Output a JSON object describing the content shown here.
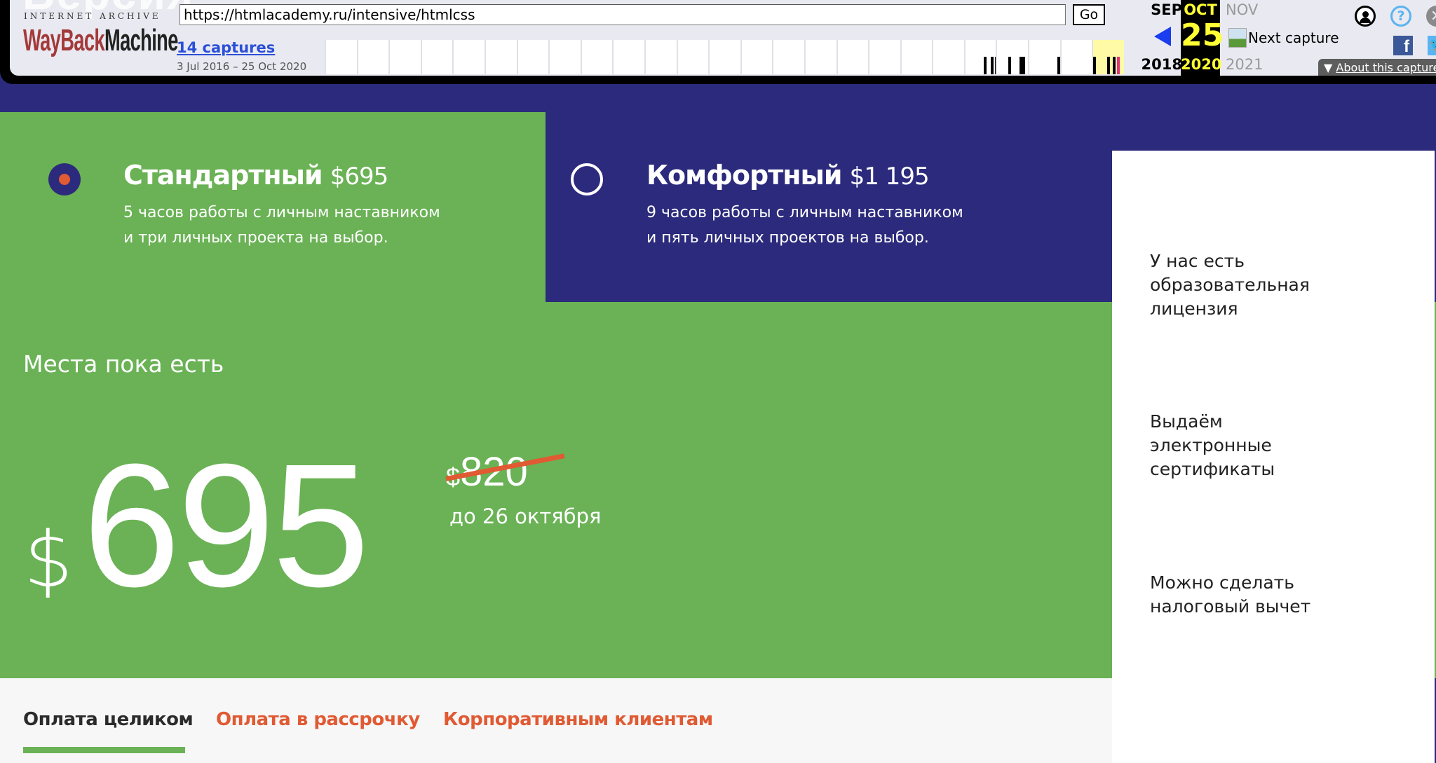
{
  "wayback": {
    "ghost_heading": "Версия",
    "ia_label": "INTERNET ARCHIVE",
    "logo_red": "WayBack",
    "logo_dark": "Machine",
    "url": "https://htmlacademy.ru/intensive/htmlcss",
    "go_label": "Go",
    "captures_link": "14 captures",
    "capture_range": "3 Jul 2016 – 25 Oct 2020",
    "calendar": {
      "prev": {
        "month": "SEP",
        "year": "2018"
      },
      "current": {
        "month": "OCT",
        "day": "25",
        "year": "2020"
      },
      "next": {
        "month": "NOV",
        "year": "2021"
      }
    },
    "next_capture_label": "Next capture",
    "about_capture_label": "About this capture",
    "icons": {
      "user": "user-account-icon",
      "help": "?",
      "close": "✕",
      "facebook": "f",
      "twitter": "🐦"
    },
    "timeline_highlight_color": "#fffaa5"
  },
  "tariffs": [
    {
      "name": "Стандартный",
      "price": "$695",
      "desc_line1": "5 часов работы с личным наставником",
      "desc_line2": "и три личных проекта на выбор.",
      "selected": true
    },
    {
      "name": "Комфортный",
      "price": "$1 195",
      "desc_line1": "9 часов работы с личным наставником",
      "desc_line2": "и пять личных проектов на выбор.",
      "selected": false
    }
  ],
  "offer": {
    "seats_text": "Места пока есть",
    "currency": "$",
    "price": "695",
    "old_currency": "$",
    "old_price": "820",
    "deadline": "до 26 октября"
  },
  "features": [
    {
      "line1": "У нас есть",
      "line2": "образовательная",
      "line3": "лицензия"
    },
    {
      "line1": "Выдаём",
      "line2": "электронные",
      "line3": "сертификаты"
    },
    {
      "line1": "Можно сделать",
      "line2": "налоговый вычет",
      "line3": ""
    }
  ],
  "payment_tabs": [
    {
      "label": "Оплата целиком",
      "active": true
    },
    {
      "label": "Оплата в рассрочку",
      "active": false
    },
    {
      "label": "Корпоративным клиентам",
      "active": false
    }
  ],
  "colors": {
    "green": "#6ab255",
    "purple": "#2c2a7c",
    "accent_orange": "#e05a33"
  }
}
